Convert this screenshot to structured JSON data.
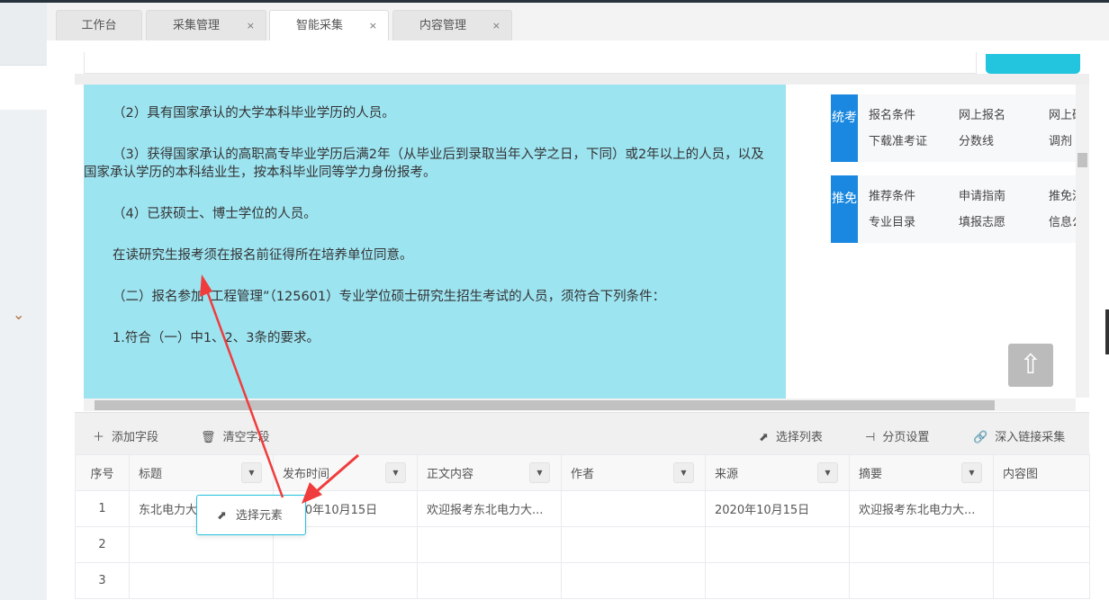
{
  "tabs": [
    {
      "label": "工作台",
      "closable": false
    },
    {
      "label": "采集管理",
      "closable": true
    },
    {
      "label": "智能采集",
      "closable": true,
      "active": true
    },
    {
      "label": "内容管理",
      "closable": true
    }
  ],
  "close_glyph": "×",
  "page_text": [
    "（2）具有国家承认的大学本科毕业学历的人员。",
    "（3）获得国家承认的高职高专毕业学历后满2年（从毕业后到录取当年入学之日，下同）或2年以上的人员，以及国家承认学历的本科结业生，按本科毕业同等学力身份报考。",
    "（4）已获硕士、博士学位的人员。",
    "在读研究生报考须在报名前征得所在培养单位同意。",
    "（二）报名参加“工程管理”（125601）专业学位硕士研究生招生考试的人员，须符合下列条件：",
    "1.符合（一）中1、2、3条的要求。"
  ],
  "nav_boxes": [
    {
      "tag": "统考",
      "items": [
        "报名条件",
        "网上报名",
        "网上确",
        "下载准考证",
        "分数线",
        "调剂"
      ]
    },
    {
      "tag": "推免",
      "items": [
        "推荐条件",
        "申请指南",
        "推免流",
        "专业目录",
        "填报志愿",
        "信息公"
      ]
    }
  ],
  "toolbar": {
    "add_field": "添加字段",
    "clear_fields": "清空字段",
    "select_list": "选择列表",
    "pagination": "分页设置",
    "deep_link": "深入链接采集"
  },
  "table": {
    "columns": [
      "序号",
      "标题",
      "发布时间",
      "正文内容",
      "作者",
      "来源",
      "摘要",
      "内容图"
    ],
    "rows": [
      [
        "1",
        "东北电力大学...",
        "2020年10月15日",
        "欢迎报考东北电力大...",
        "",
        "2020年10月15日",
        "欢迎报考东北电力大...",
        ""
      ],
      [
        "2",
        "",
        "",
        "",
        "",
        "",
        "",
        ""
      ],
      [
        "3",
        "",
        "",
        "",
        "",
        "",
        "",
        ""
      ]
    ]
  },
  "popup": {
    "label": "选择元素"
  },
  "colors": {
    "accent": "#22c4de",
    "highlight": "#9de4f1",
    "nav_tag": "#1a88e0",
    "arrow": "#f03c3c"
  }
}
